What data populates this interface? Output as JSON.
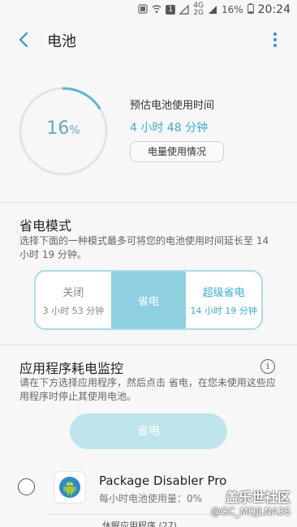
{
  "status_bar": {
    "sim_indicator": "1",
    "network_label_top": "4G",
    "network_label_bottom": "2G",
    "network_label_2": "4G",
    "battery_percent": "16%",
    "time": "20:24"
  },
  "app_bar": {
    "title": "电池"
  },
  "summary": {
    "battery_level": "16",
    "battery_unit": "%",
    "battery_level_fraction": 0.16,
    "estimate_label": "预估电池使用时间",
    "estimate_value": "4 小时 48 分钟",
    "usage_button": "电量使用情况"
  },
  "power_mode": {
    "title": "省电模式",
    "description": "选择下面的一种模式最多可将您的电池使用时间延长至 14 小时 19 分钟。",
    "modes": [
      {
        "label": "关闭",
        "time": "3 小时 53 分钟"
      },
      {
        "label": "省电",
        "time": ""
      },
      {
        "label": "超级省电",
        "time": "14 小时 19 分钟"
      }
    ],
    "selected_index": 1
  },
  "app_monitor": {
    "title": "应用程序耗电监控",
    "description": "请在下方选择应用程序，然后点击 省电，在您未使用这些应用程序时停止其使用电池。",
    "save_button": "省电",
    "apps": [
      {
        "name": "Package Disabler Pro",
        "usage": "每小时电池使用量：0%"
      }
    ],
    "sleeping_section": "休眠应用程序 (27)"
  },
  "watermark": {
    "line1": "盖乐世社区",
    "line2": "@GC_MQJLNA3S"
  },
  "colors": {
    "accent": "#3aaed3",
    "ring_arc": "#5bb7d3",
    "active_mode": "#8fd0e1",
    "disabled_button": "#bfe4ec"
  }
}
